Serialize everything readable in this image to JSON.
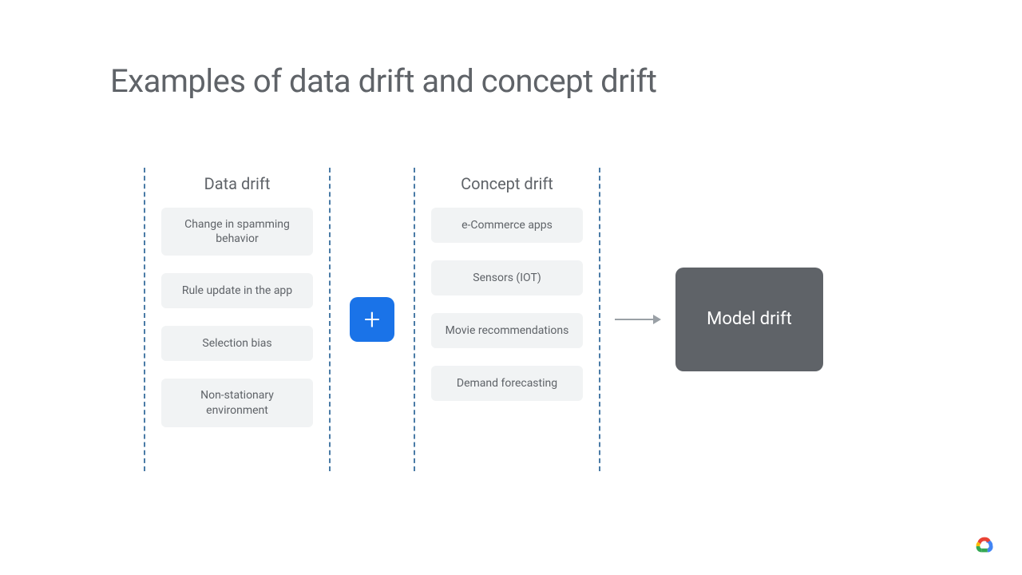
{
  "title": "Examples of data drift and concept drift",
  "columns": {
    "left": {
      "heading": "Data drift",
      "items": [
        "Change in spamming behavior",
        "Rule update in the app",
        "Selection bias",
        "Non-stationary environment"
      ]
    },
    "right": {
      "heading": "Concept drift",
      "items": [
        "e-Commerce apps",
        "Sensors (IOT)",
        "Movie recommendations",
        "Demand forecasting"
      ]
    }
  },
  "operator": "+",
  "result": "Model drift"
}
